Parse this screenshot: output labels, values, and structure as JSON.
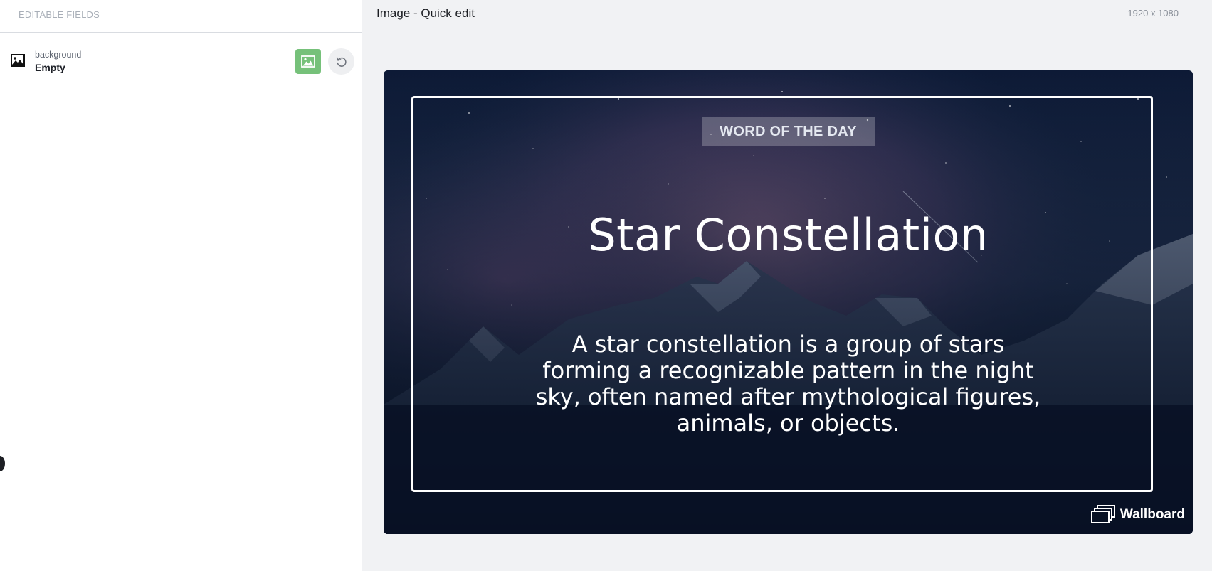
{
  "panel": {
    "header_title": "EDITABLE FIELDS",
    "field": {
      "name": "background",
      "value": "Empty",
      "icon": "image-icon",
      "action_icon": "image-icon",
      "reset_icon": "undo-icon"
    }
  },
  "editor": {
    "title": "Image - Quick edit",
    "dimensions": "1920 x 1080"
  },
  "preview": {
    "badge": "WORD OF THE DAY",
    "headline": "Star Constellation",
    "description": "A star constellation is a group of stars forming a recognizable pattern in the night sky, often named after mythological figures, animals, or objects.",
    "brand": "Wallboard",
    "colors": {
      "action_button": "#76c17a",
      "sky_top": "#0d1a36",
      "nebula": "#6d4f7a"
    }
  }
}
